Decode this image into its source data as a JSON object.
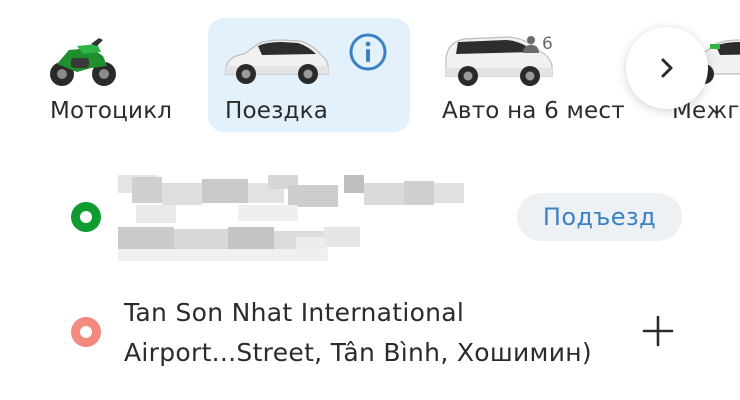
{
  "ride_types": [
    {
      "id": "moto",
      "label": "Мотоцикл",
      "icon": "motorbike-icon",
      "selected": false
    },
    {
      "id": "ride",
      "label": "Поездка",
      "icon": "car-icon",
      "selected": true,
      "info_icon": "info-icon"
    },
    {
      "id": "six",
      "label": "Авто на 6 мест",
      "icon": "minivan-icon",
      "selected": false,
      "capacity": "6"
    },
    {
      "id": "intercity",
      "label": "Межг",
      "icon": "car-icon",
      "selected": false
    }
  ],
  "next_button_icon": "chevron-right-icon",
  "pickup": {
    "dot_icon": "pickup-dot-icon",
    "entrance_label": "Подъезд",
    "accent": "#0e9b30"
  },
  "destination": {
    "dot_icon": "destination-dot-icon",
    "line1": "Tan Son Nhat International",
    "line2": "Airport...Street, Tân Bình, Хошимин)",
    "add_stop_icon": "plus-icon",
    "accent": "#f28a7f"
  },
  "colors": {
    "selected_bg": "#e3f1fd",
    "link_blue": "#3b82c4"
  }
}
